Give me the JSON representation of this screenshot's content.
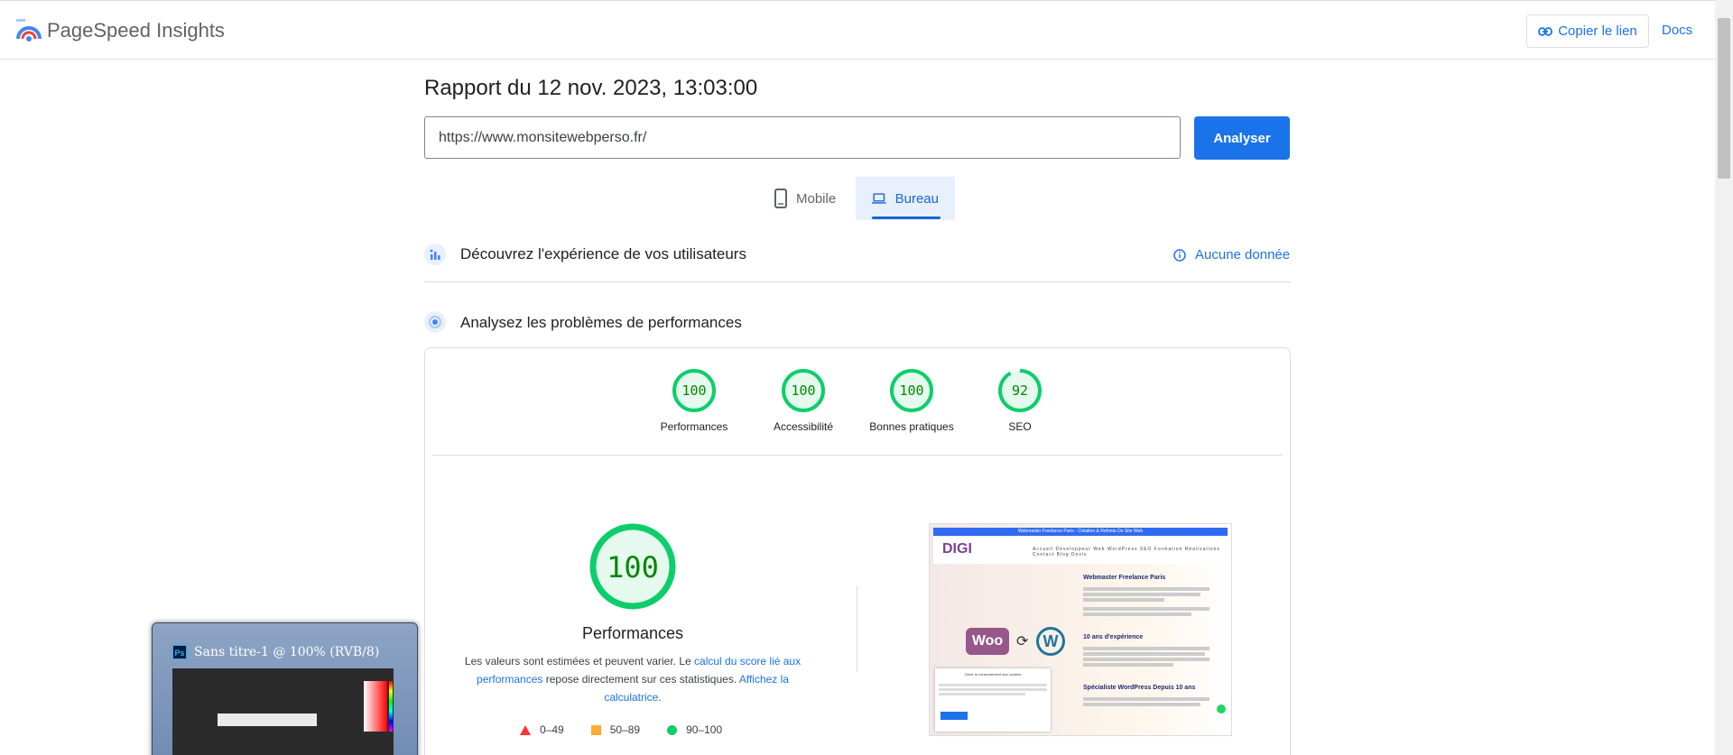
{
  "header": {
    "app_title": "PageSpeed Insights",
    "copy_link_label": "Copier le lien",
    "docs_label": "Docs"
  },
  "report": {
    "title": "Rapport du 12 nov. 2023, 13:03:00",
    "url_value": "https://www.monsitewebperso.fr/",
    "analyze_label": "Analyser"
  },
  "tabs": [
    {
      "label": "Mobile",
      "icon": "smartphone-icon",
      "selected": false
    },
    {
      "label": "Bureau",
      "icon": "laptop-icon",
      "selected": true
    }
  ],
  "sections": {
    "ux_title": "Découvrez l'expérience de vos utilisateurs",
    "no_data_label": "Aucune donnée",
    "perf_title": "Analysez les problèmes de performances"
  },
  "scores": [
    {
      "label": "Performances",
      "value": "100",
      "fraction": 1.0
    },
    {
      "label": "Accessibilité",
      "value": "100",
      "fraction": 1.0
    },
    {
      "label": "Bonnes pratiques",
      "value": "100",
      "fraction": 1.0
    },
    {
      "label": "SEO",
      "value": "92",
      "fraction": 0.92
    }
  ],
  "main_score": {
    "value": "100",
    "label": "Performances",
    "desc_prefix": "Les valeurs sont estimées et peuvent varier. Le ",
    "desc_link1": "calcul du score lié aux performances",
    "desc_middle": " repose directement sur ces statistiques. ",
    "desc_link2": "Affichez la calculatrice",
    "desc_suffix": "."
  },
  "legend": [
    {
      "label": "0–49",
      "color": "#ff3333"
    },
    {
      "label": "50–89",
      "color": "#ffaa33"
    },
    {
      "label": "90–100",
      "color": "#0cce6b"
    }
  ],
  "thumbnail": {
    "top_bar": "Webmaster Freelance Paris - Création & Refonte De Site Web",
    "logo": "DIGI",
    "menu": "Accueil  Développeur Web  WordPress  SEO  Formation  Réalisations  Contact  Blog  Devis",
    "woo": "Woo",
    "wp": "W",
    "h1": "Webmaster Freelance Paris",
    "h2": "10 ans d'expérience",
    "h3": "Spécialiste WordPress Depuis 10 ans",
    "cookie_title": "Gérer le consentement aux cookies"
  },
  "taskbar_preview": {
    "app_icon": "Ps",
    "title": "Sans titre-1 @ 100% (RVB/8)"
  },
  "colors": {
    "accent": "#1a73e8",
    "pass": "#0cce6b",
    "pass_text": "#008800",
    "pass_bg": "#e6f9ee"
  }
}
